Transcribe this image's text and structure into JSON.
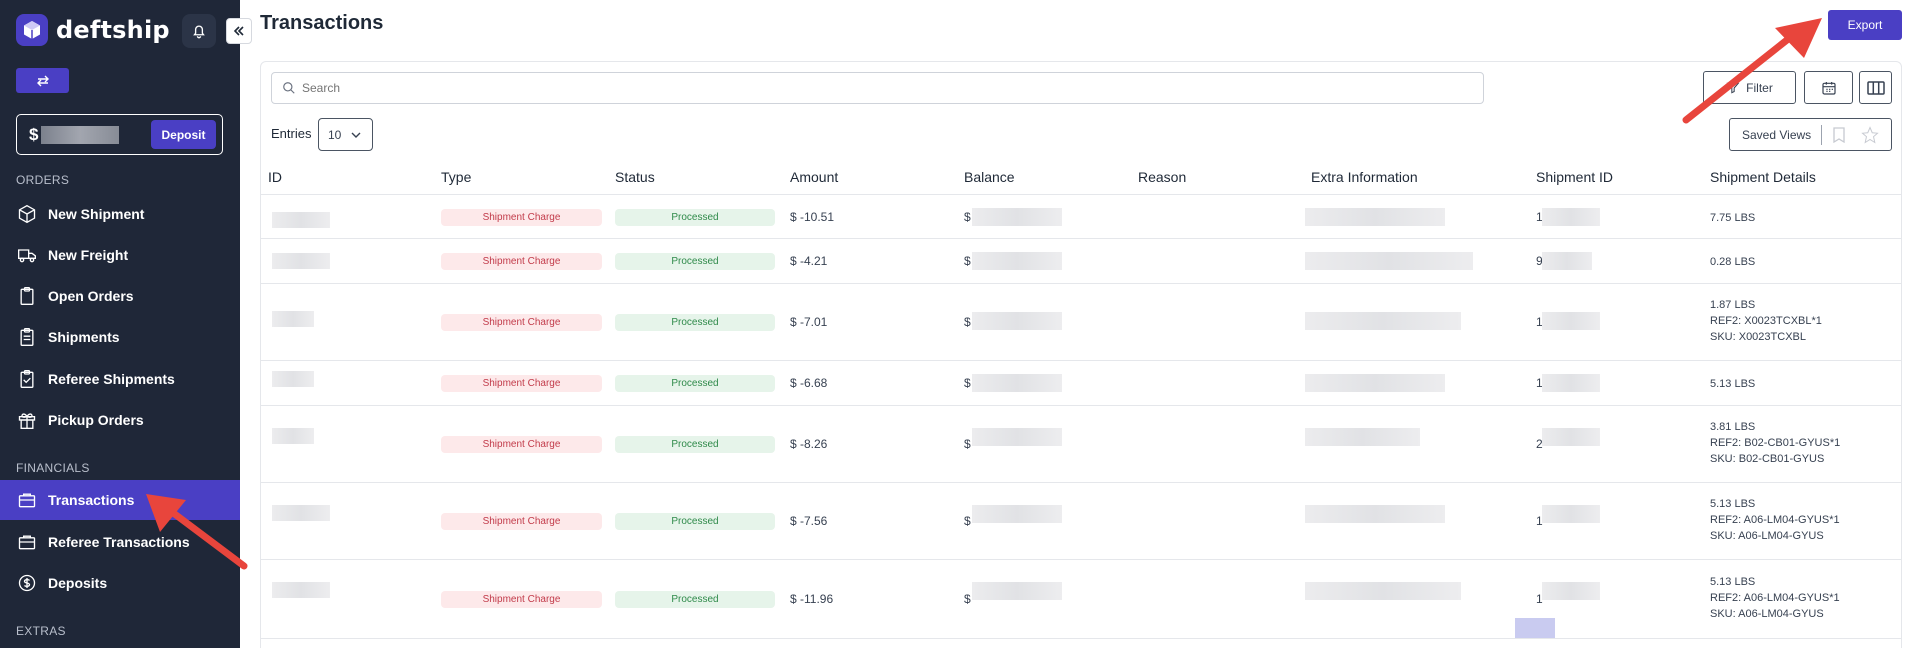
{
  "app": {
    "name": "deftship",
    "page_title": "Transactions"
  },
  "sidebar": {
    "balance_prefix": "$",
    "deposit_label": "Deposit",
    "sections": {
      "orders": "ORDERS",
      "financials": "FINANCIALS",
      "extras": "EXTRAS"
    },
    "items": [
      {
        "label": "New Shipment",
        "icon": "box-icon"
      },
      {
        "label": "New Freight",
        "icon": "truck-icon"
      },
      {
        "label": "Open Orders",
        "icon": "clipboard-icon"
      },
      {
        "label": "Shipments",
        "icon": "clipboard-list-icon"
      },
      {
        "label": "Referee Shipments",
        "icon": "clipboard-check-icon"
      },
      {
        "label": "Pickup Orders",
        "icon": "gift-box-icon"
      },
      {
        "label": "Transactions",
        "icon": "briefcase-icon",
        "active": true
      },
      {
        "label": "Referee Transactions",
        "icon": "briefcase-icon"
      },
      {
        "label": "Deposits",
        "icon": "dollar-circle-icon"
      }
    ]
  },
  "toolbar": {
    "export_label": "Export",
    "search_placeholder": "Search",
    "filter_label": "Filter",
    "entries_label": "Entries",
    "entries_value": "10",
    "saved_views_label": "Saved Views"
  },
  "table": {
    "columns": [
      "ID",
      "Type",
      "Status",
      "Amount",
      "Balance",
      "Reason",
      "Extra Information",
      "Shipment ID",
      "Shipment Details"
    ],
    "rows": [
      {
        "type": "Shipment Charge",
        "status": "Processed",
        "amount": "$ -10.51",
        "balance_prefix": "$",
        "shipment_id_prefix": "1",
        "details": [
          "7.75 LBS"
        ]
      },
      {
        "type": "Shipment Charge",
        "status": "Processed",
        "amount": "$ -4.21",
        "balance_prefix": "$",
        "shipment_id_prefix": "9",
        "details": [
          "0.28 LBS"
        ]
      },
      {
        "type": "Shipment Charge",
        "status": "Processed",
        "amount": "$ -7.01",
        "balance_prefix": "$",
        "shipment_id_prefix": "1",
        "details": [
          "1.87 LBS",
          "REF2: X0023TCXBL*1",
          "SKU: X0023TCXBL"
        ]
      },
      {
        "type": "Shipment Charge",
        "status": "Processed",
        "amount": "$ -6.68",
        "balance_prefix": "$",
        "shipment_id_prefix": "1",
        "details": [
          "5.13 LBS"
        ]
      },
      {
        "type": "Shipment Charge",
        "status": "Processed",
        "amount": "$ -8.26",
        "balance_prefix": "$",
        "shipment_id_prefix": "2",
        "details": [
          "3.81 LBS",
          "REF2: B02-CB01-GYUS*1",
          "SKU: B02-CB01-GYUS"
        ]
      },
      {
        "type": "Shipment Charge",
        "status": "Processed",
        "amount": "$ -7.56",
        "balance_prefix": "$",
        "shipment_id_prefix": "1",
        "details": [
          "5.13 LBS",
          "REF2: A06-LM04-GYUS*1",
          "SKU: A06-LM04-GYUS"
        ]
      },
      {
        "type": "Shipment Charge",
        "status": "Processed",
        "amount": "$ -11.96",
        "balance_prefix": "$",
        "shipment_id_prefix": "1",
        "details": [
          "5.13 LBS",
          "REF2: A06-LM04-GYUS*1",
          "SKU: A06-LM04-GYUS"
        ]
      }
    ]
  },
  "colors": {
    "sidebar_bg": "#1f2738",
    "accent": "#4a3fc4",
    "type_pill_bg": "#fde9ea",
    "type_pill_text": "#c23b4a",
    "status_pill_bg": "#e6f4ea",
    "status_pill_text": "#2f8a4a",
    "annotation_arrow": "#e8453c"
  }
}
